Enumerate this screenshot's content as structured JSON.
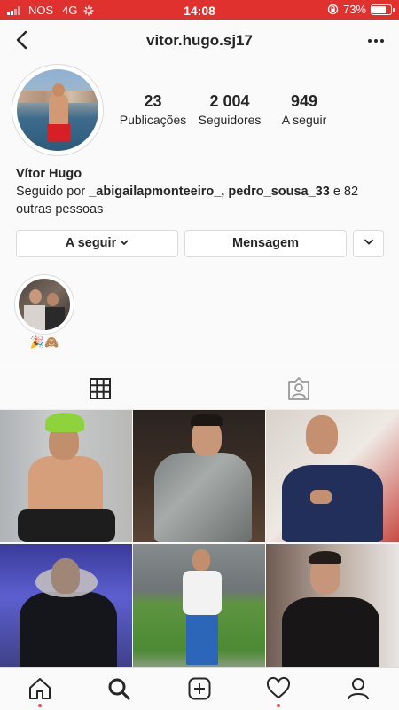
{
  "status_bar": {
    "carrier": "NOS",
    "network": "4G",
    "time": "14:08",
    "battery": "73%",
    "battery_level": 0.73,
    "icons": [
      "signal-bars-icon",
      "activity-spinner-icon",
      "rotation-lock-icon",
      "battery-icon"
    ]
  },
  "header": {
    "username": "vitor.hugo.sj17",
    "back_icon": "chevron-left-icon",
    "more_icon": "more-horizontal-icon"
  },
  "profile": {
    "stats": [
      {
        "value": "23",
        "label": "Publicações"
      },
      {
        "value": "2 004",
        "label": "Seguidores"
      },
      {
        "value": "949",
        "label": "A seguir"
      }
    ],
    "name": "Vítor Hugo",
    "followed_by_prefix": "Seguido por ",
    "followed_by_users": "_abigailapmonteeiro_, pedro_sousa_33",
    "followed_by_suffix": " e 82 outras pessoas"
  },
  "actions": {
    "following_label": "A seguir",
    "message_label": "Mensagem",
    "following_icon": "chevron-down-icon",
    "suggest_icon": "chevron-down-icon"
  },
  "highlights": [
    {
      "label": "🎉🙈"
    }
  ],
  "tabs": [
    {
      "name": "posts-grid",
      "icon": "grid-icon",
      "active": true
    },
    {
      "name": "tagged",
      "icon": "tagged-user-icon",
      "active": false
    }
  ],
  "posts": [
    {
      "id": 1
    },
    {
      "id": 2
    },
    {
      "id": 3
    },
    {
      "id": 4
    },
    {
      "id": 5
    },
    {
      "id": 6
    }
  ],
  "bottom_nav": [
    {
      "name": "home",
      "icon": "home-icon",
      "badge": true
    },
    {
      "name": "search",
      "icon": "search-icon",
      "badge": false
    },
    {
      "name": "new-post",
      "icon": "plus-square-icon",
      "badge": false
    },
    {
      "name": "activity",
      "icon": "heart-icon",
      "badge": true
    },
    {
      "name": "profile",
      "icon": "user-icon",
      "badge": false
    }
  ],
  "colors": {
    "status_bar": "#e0312f",
    "text": "#262626",
    "border": "#dbdbdb",
    "badge": "#ed4956",
    "background": "#fafafa"
  }
}
